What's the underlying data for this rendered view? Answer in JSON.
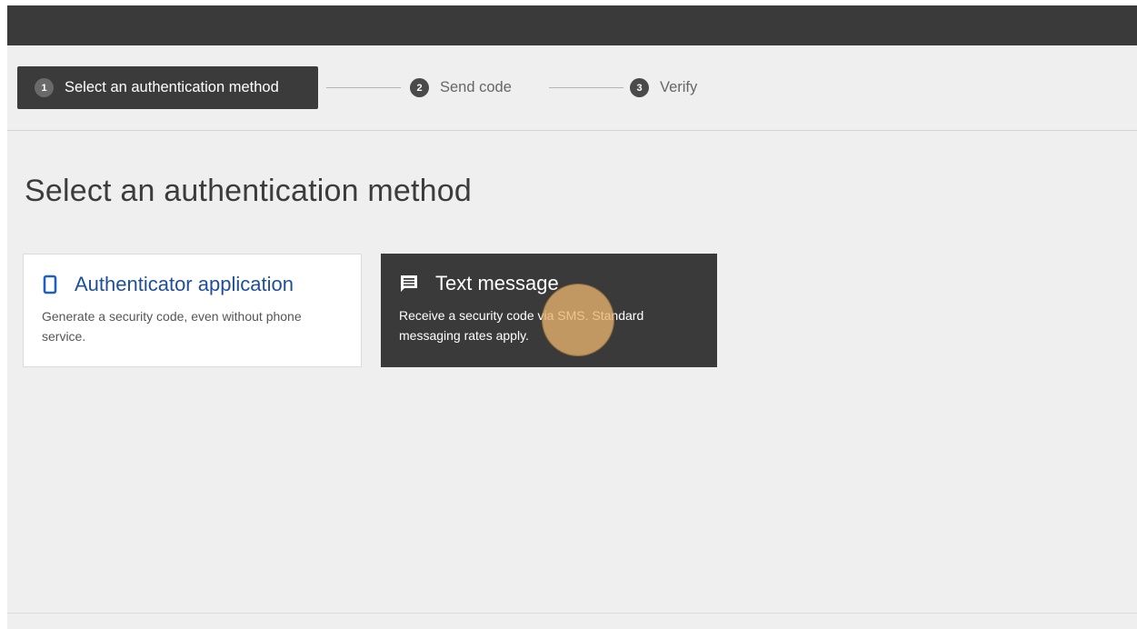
{
  "stepper": {
    "steps": [
      {
        "number": "1",
        "label": "Select an authentication method",
        "state": "active"
      },
      {
        "number": "2",
        "label": "Send code",
        "state": "inactive"
      },
      {
        "number": "3",
        "label": "Verify",
        "state": "inactive"
      }
    ]
  },
  "page": {
    "title": "Select an authentication method"
  },
  "methods": [
    {
      "icon": "phone-icon",
      "title": "Authenticator application",
      "description": "Generate a security code, even without phone service."
    },
    {
      "icon": "message-icon",
      "title": "Text message",
      "description": "Receive a security code via SMS. Standard messaging rates apply."
    }
  ],
  "colors": {
    "topbar": "#3a3a3a",
    "background": "#efefef",
    "active_card": "#3a3a3a",
    "link_blue": "#1f4f9c",
    "click_highlight": "#e8b46e"
  }
}
